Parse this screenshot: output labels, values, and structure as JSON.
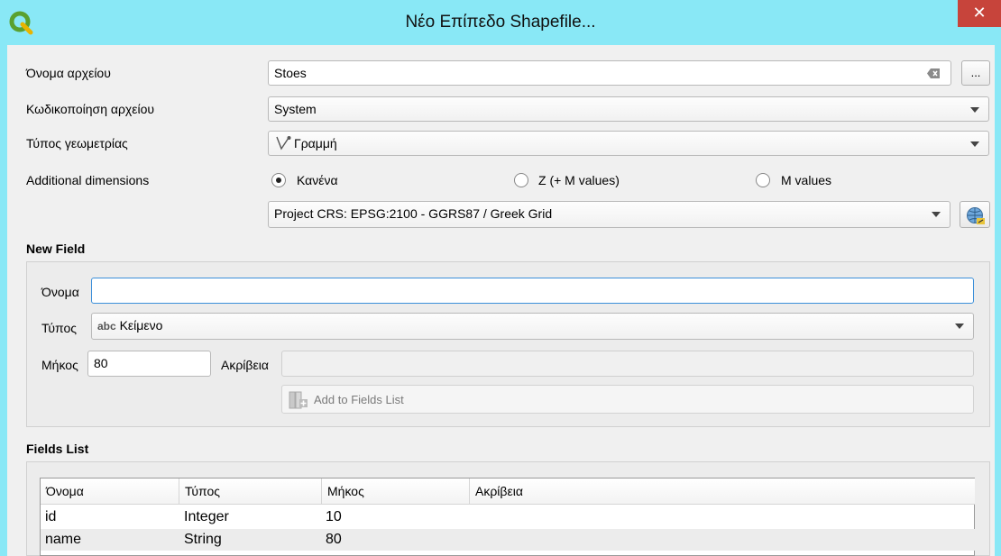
{
  "window": {
    "title": "Νέο Επίπεδο Shapefile...",
    "close_glyph": "✕"
  },
  "form": {
    "file_name_label": "Όνομα αρχείου",
    "file_name_value": "Stoes",
    "browse_label": "...",
    "encoding_label": "Κωδικοποίηση αρχείου",
    "encoding_value": "System",
    "geometry_label": "Τύπος γεωμετρίας",
    "geometry_value": "Γραμμή",
    "dimensions_label": "Additional dimensions",
    "dimension_options": [
      "Κανένα",
      "Z (+ M values)",
      "M values"
    ],
    "dimension_selected": "Κανένα",
    "crs_value": "Project CRS: EPSG:2100 - GGRS87 / Greek Grid"
  },
  "new_field": {
    "section_title": "New Field",
    "name_label": "Όνομα",
    "name_value": "",
    "type_label": "Τύπος",
    "type_badge": "abc",
    "type_value": "Κείμενο",
    "length_label": "Μήκος",
    "length_value": "80",
    "precision_label": "Ακρίβεια",
    "precision_value": "",
    "add_button_label": "Add to Fields List"
  },
  "fields_list": {
    "section_title": "Fields List",
    "columns": [
      "Όνομα",
      "Τύπος",
      "Μήκος",
      "Ακρίβεια"
    ],
    "rows": [
      {
        "name": "id",
        "type": "Integer",
        "length": "10",
        "precision": ""
      },
      {
        "name": "name",
        "type": "String",
        "length": "80",
        "precision": ""
      }
    ]
  },
  "icons": {
    "app": "qgis-logo-icon",
    "clear": "clear-text-icon",
    "geometry": "line-geometry-icon",
    "crs": "crs-globe-icon",
    "add_field": "add-field-icon"
  },
  "colors": {
    "titlebar": "#89e8f6",
    "close": "#c7443b",
    "focus_border": "#3c8fd9",
    "selected_row": "#ececec"
  }
}
